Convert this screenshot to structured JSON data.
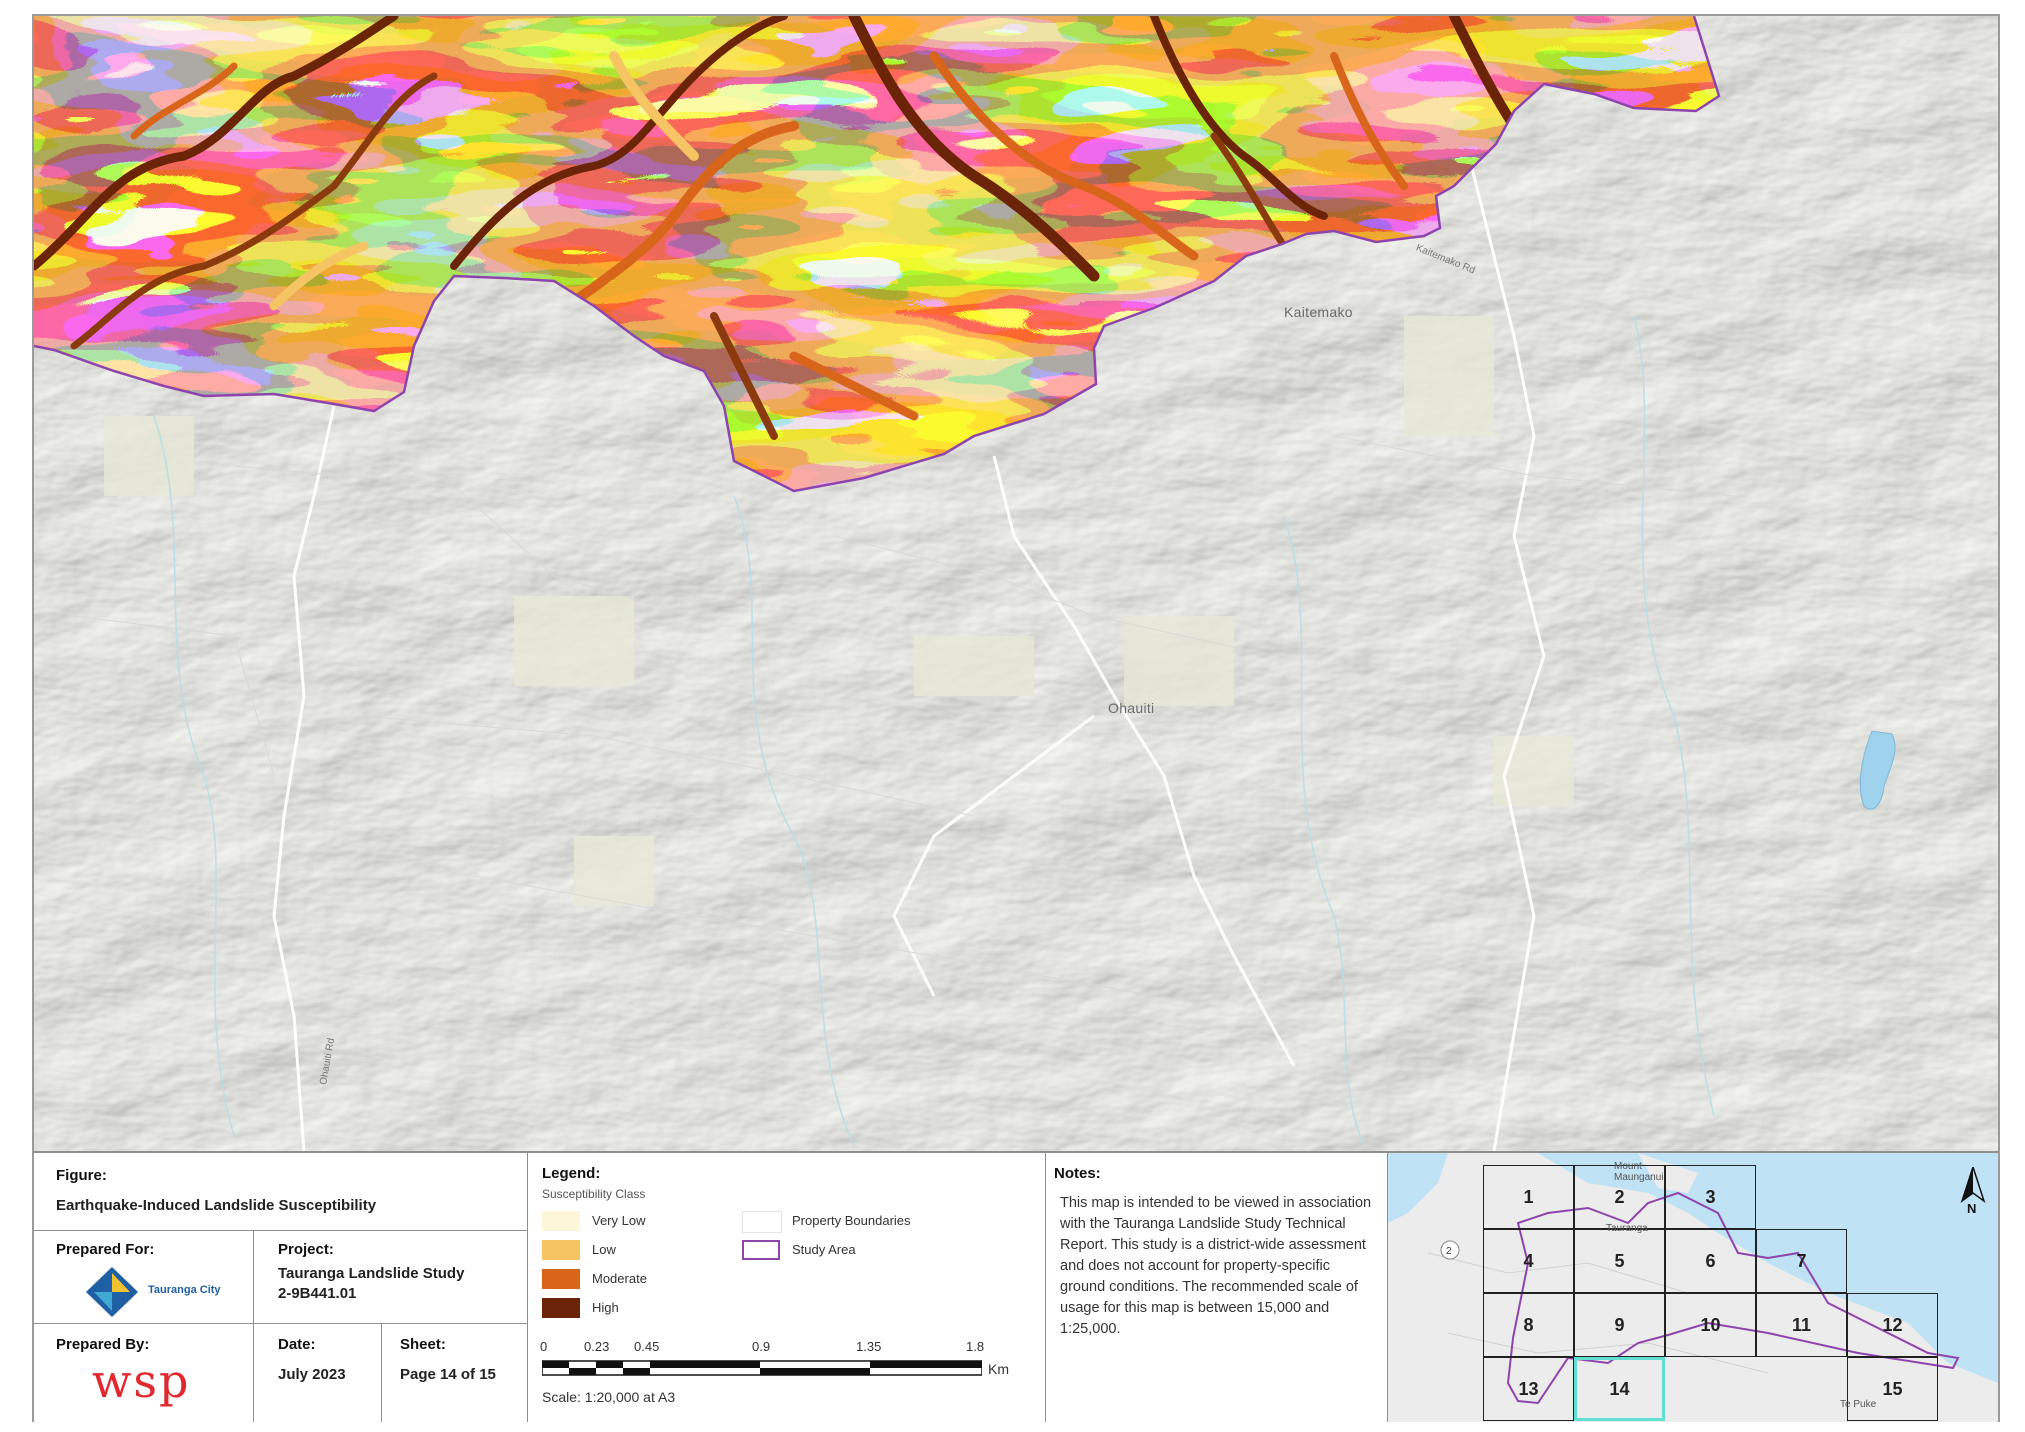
{
  "map": {
    "places": [
      "Kaitemako",
      "Ohauiti"
    ],
    "roads": [
      "Kaitemako Rd",
      "Ohauiti Rd"
    ]
  },
  "legend": {
    "title": "Legend:",
    "subtitle": "Susceptibility Class",
    "classes": [
      {
        "label": "Very Low",
        "color": "#fdf6d8"
      },
      {
        "label": "Low",
        "color": "#f6c462"
      },
      {
        "label": "Moderate",
        "color": "#d9651a"
      },
      {
        "label": "High",
        "color": "#6b2407"
      }
    ],
    "others": [
      {
        "label": "Property Boundaries",
        "color": "#e8e8e8"
      },
      {
        "label": "Study Area",
        "color": "#8e44ad"
      }
    ]
  },
  "figure": {
    "label": "Figure:",
    "title": "Earthquake-Induced Landslide Susceptibility"
  },
  "prepared_for": {
    "label": "Prepared For:",
    "logo_text": "Tauranga City"
  },
  "project": {
    "label": "Project:",
    "name": "Tauranga Landslide Study",
    "number": "2-9B441.01"
  },
  "prepared_by": {
    "label": "Prepared By:",
    "logo_text": "wsp"
  },
  "date": {
    "label": "Date:",
    "value": "July 2023"
  },
  "sheet": {
    "label": "Sheet:",
    "value": "Page 14 of 15"
  },
  "scalebar": {
    "ticks": [
      "0",
      "0.23",
      "0.45",
      "0.9",
      "1.35",
      "1.8"
    ],
    "unit": "Km",
    "text": "Scale: 1:20,000 at A3"
  },
  "notes": {
    "label": "Notes:",
    "body": "This map is intended to be viewed in association with the Tauranga Landslide Study Technical Report. This study is a district-wide assessment and does not account for property-specific ground conditions. The recommended scale of usage for this map is between 15,000 and 1:25,000."
  },
  "index_map": {
    "tiles": [
      "1",
      "2",
      "3",
      "4",
      "5",
      "6",
      "7",
      "8",
      "9",
      "10",
      "11",
      "12",
      "13",
      "14",
      "15"
    ],
    "current": "14",
    "labels": [
      "Mount Maunganui",
      "Tauranga",
      "Te Puke",
      "2"
    ],
    "north": "N"
  },
  "colors": {
    "very_low": "#fdf6d8",
    "low": "#f6c462",
    "moderate": "#d9651a",
    "high": "#6b2407",
    "study_area": "#8e44ad",
    "current_tile": "#5fe0d0",
    "sea": "#bfe3f5"
  }
}
